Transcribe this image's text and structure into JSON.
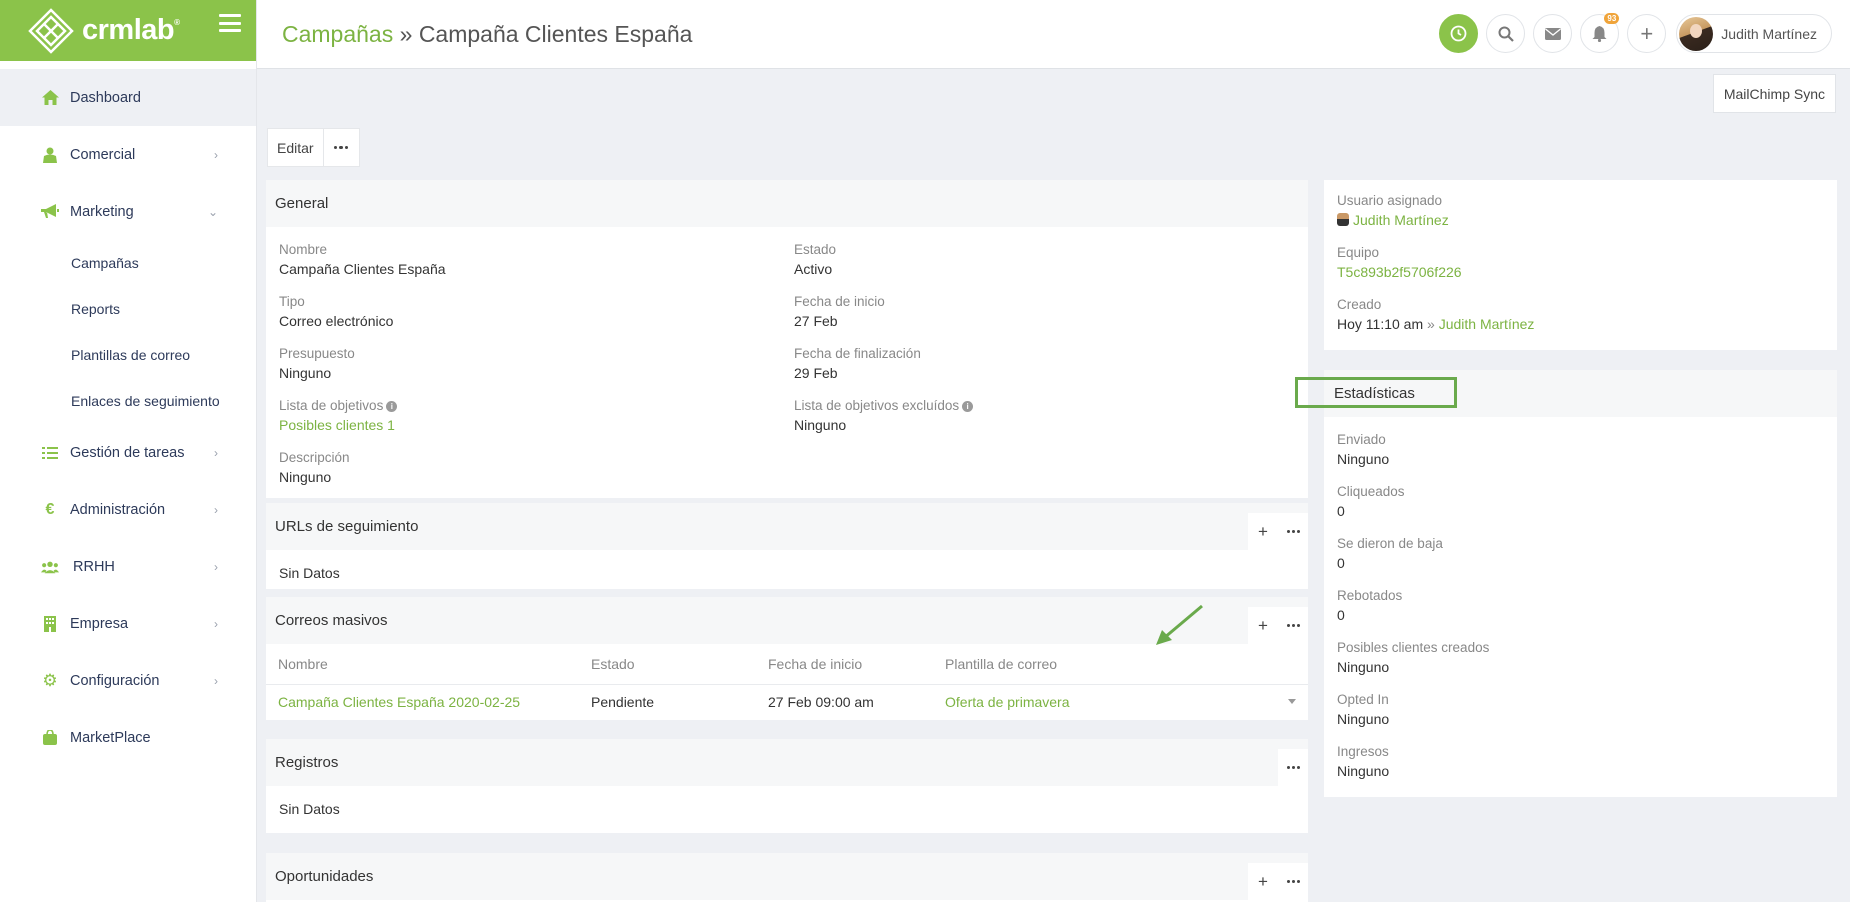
{
  "brand": {
    "logo_text": "crmlab",
    "logo_mark": "®",
    "color": "#8bc34a"
  },
  "sidebar": {
    "items": [
      {
        "label": "Dashboard",
        "icon": "home-icon",
        "active": true
      },
      {
        "label": "Comercial",
        "icon": "user-icon",
        "expandable": true
      },
      {
        "label": "Marketing",
        "icon": "megaphone-icon",
        "expanded": true
      },
      {
        "label": "Gestión de tareas",
        "icon": "tasks-icon",
        "expandable": true
      },
      {
        "label": "Administración",
        "icon": "euro-icon",
        "expandable": true
      },
      {
        "label": "RRHH",
        "icon": "users-icon",
        "expandable": true
      },
      {
        "label": "Empresa",
        "icon": "building-icon",
        "expandable": true
      },
      {
        "label": "Configuración",
        "icon": "gear-icon",
        "expandable": true
      },
      {
        "label": "MarketPlace",
        "icon": "bag-icon"
      }
    ],
    "marketing_sub": [
      "Campañas",
      "Reports",
      "Plantillas de correo",
      "Enlaces de seguimiento"
    ]
  },
  "header": {
    "crumb_parent": "Campañas",
    "crumb_sep": " » ",
    "crumb_current": "Campaña Clientes España",
    "notification_count": "93",
    "user_name": "Judith Martínez"
  },
  "actions": {
    "mailchimp": "MailChimp Sync",
    "edit": "Editar"
  },
  "general": {
    "title": "General",
    "fields": {
      "nombre": {
        "label": "Nombre",
        "value": "Campaña Clientes España"
      },
      "estado": {
        "label": "Estado",
        "value": "Activo"
      },
      "tipo": {
        "label": "Tipo",
        "value": "Correo electrónico"
      },
      "fecha_inicio": {
        "label": "Fecha de inicio",
        "value": "27 Feb"
      },
      "presupuesto": {
        "label": "Presupuesto",
        "value": "Ninguno"
      },
      "fecha_fin": {
        "label": "Fecha de finalización",
        "value": "29 Feb"
      },
      "lista_obj": {
        "label": "Lista de objetivos",
        "value": "Posibles clientes 1"
      },
      "lista_excl": {
        "label": "Lista de objetivos excluídos",
        "value": "Ninguno"
      },
      "descripcion": {
        "label": "Descripción",
        "value": "Ninguno"
      }
    }
  },
  "urls": {
    "title": "URLs de seguimiento",
    "empty": "Sin Datos"
  },
  "correos": {
    "title": "Correos masivos",
    "columns": [
      "Nombre",
      "Estado",
      "Fecha de inicio",
      "Plantilla de correo"
    ],
    "rows": [
      {
        "nombre": "Campaña Clientes España 2020-02-25",
        "estado": "Pendiente",
        "fecha": "27 Feb 09:00 am",
        "plantilla": "Oferta de primavera"
      }
    ]
  },
  "registros": {
    "title": "Registros",
    "empty": "Sin Datos"
  },
  "oportunidades": {
    "title": "Oportunidades"
  },
  "side_info": {
    "usuario_label": "Usuario asignado",
    "usuario_value": "Judith Martínez",
    "equipo_label": "Equipo",
    "equipo_value": "T5c893b2f5706f226",
    "creado_label": "Creado",
    "creado_time": "Hoy 11:10 am",
    "creado_sep": " » ",
    "creado_user": "Judith Martínez"
  },
  "stats": {
    "title": "Estadísticas",
    "items": [
      {
        "label": "Enviado",
        "value": "Ninguno"
      },
      {
        "label": "Cliqueados",
        "value": "0"
      },
      {
        "label": "Se dieron de baja",
        "value": "0"
      },
      {
        "label": "Rebotados",
        "value": "0"
      },
      {
        "label": "Posibles clientes creados",
        "value": "Ninguno"
      },
      {
        "label": "Opted In",
        "value": "Ninguno"
      },
      {
        "label": "Ingresos",
        "value": "Ninguno"
      }
    ]
  }
}
